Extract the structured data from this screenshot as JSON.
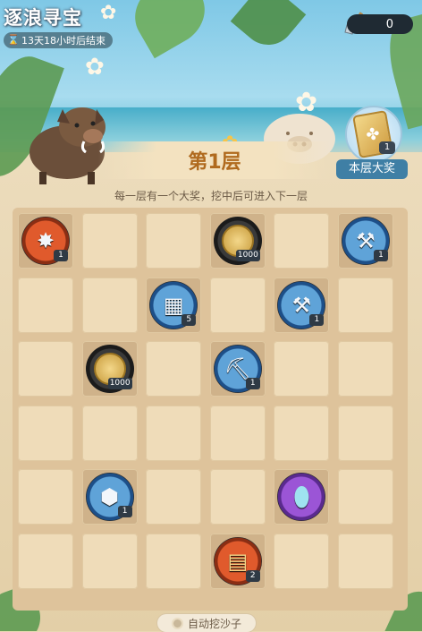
{
  "header": {
    "title": "逐浪寻宝",
    "timer_text": "13天18小时后结束",
    "counter_value": "0"
  },
  "layer": {
    "label": "第1层",
    "prize_label": "本层大奖",
    "prize_count": "1"
  },
  "hint": "每一层有一个大奖，挖中后可进入下一层",
  "grid": {
    "cols": 6,
    "rows": 6,
    "items": [
      {
        "row": 0,
        "col": 0,
        "icon": "ice-crystal-icon",
        "ring": "orange",
        "count": "1"
      },
      {
        "row": 0,
        "col": 3,
        "icon": "gold-coin-icon",
        "ring": "dark",
        "count": "1000"
      },
      {
        "row": 0,
        "col": 5,
        "icon": "hammer-icon",
        "ring": "blue",
        "count": "1"
      },
      {
        "row": 1,
        "col": 2,
        "icon": "crystal-card-icon",
        "ring": "blue",
        "count": "5"
      },
      {
        "row": 1,
        "col": 4,
        "icon": "hammer-icon",
        "ring": "blue",
        "count": "1"
      },
      {
        "row": 2,
        "col": 1,
        "icon": "gold-coin-icon",
        "ring": "dark",
        "count": "1000"
      },
      {
        "row": 2,
        "col": 3,
        "icon": "pickaxe-icon",
        "ring": "blue",
        "count": "1"
      },
      {
        "row": 4,
        "col": 1,
        "icon": "ore-icon",
        "ring": "blue",
        "count": "1"
      },
      {
        "row": 4,
        "col": 4,
        "icon": "egg-icon",
        "ring": "purple",
        "count": ""
      },
      {
        "row": 5,
        "col": 3,
        "icon": "gold-card-icon",
        "ring": "orange",
        "count": "2"
      }
    ]
  },
  "footer": {
    "auto_dig_label": "自动挖沙子"
  },
  "colors": {
    "accent": "#b06a1e",
    "prize_tag": "#3f7fa5",
    "board": "#dec39b"
  }
}
